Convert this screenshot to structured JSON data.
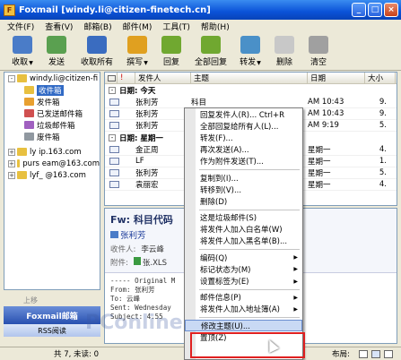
{
  "window": {
    "title": "Foxmail [windy.li@citizen-finetech.cn]",
    "app_icon": "F"
  },
  "menu": [
    "文件(F)",
    "查看(V)",
    "邮箱(B)",
    "邮件(M)",
    "工具(T)",
    "帮助(H)"
  ],
  "toolbar": [
    {
      "label": "收取",
      "icon": "receive-icon",
      "color": "#4a7cc8",
      "dropdown": true
    },
    {
      "label": "发送",
      "icon": "send-icon",
      "color": "#5aa050",
      "dropdown": false
    },
    {
      "label": "收取所有",
      "icon": "receive-all-icon",
      "color": "#3a6cc0",
      "dropdown": false
    },
    {
      "label": "撰写",
      "icon": "compose-icon",
      "color": "#e0a020",
      "dropdown": true
    },
    {
      "label": "回复",
      "icon": "reply-icon",
      "color": "#70a830",
      "dropdown": false
    },
    {
      "label": "全部回复",
      "icon": "reply-all-icon",
      "color": "#70a830",
      "dropdown": false
    },
    {
      "label": "转发",
      "icon": "forward-icon",
      "color": "#4a90c8",
      "dropdown": true
    },
    {
      "label": "删除",
      "icon": "delete-icon",
      "color": "#c8c8c8",
      "dropdown": false
    },
    {
      "label": "清空",
      "icon": "empty-trash-icon",
      "color": "#a0a0a0",
      "dropdown": false
    }
  ],
  "folders": [
    {
      "label": "windy.li@citizen-fi",
      "level": 0,
      "exp": "-",
      "color": "#e8c040",
      "selected": false
    },
    {
      "label": "收件箱",
      "level": 1,
      "exp": "",
      "color": "#e8c040",
      "selected": true
    },
    {
      "label": "发件箱",
      "level": 1,
      "exp": "",
      "color": "#e8a030",
      "selected": false
    },
    {
      "label": "已发送邮件箱",
      "level": 1,
      "exp": "",
      "color": "#d05050",
      "selected": false
    },
    {
      "label": "垃圾邮件箱",
      "level": 1,
      "exp": "",
      "color": "#a060c0",
      "selected": false
    },
    {
      "label": "废件箱",
      "level": 1,
      "exp": "",
      "color": "#9098a0",
      "selected": false
    },
    {
      "label": "ly   ip.163.com",
      "level": 0,
      "exp": "+",
      "color": "#e8c040",
      "selected": false
    },
    {
      "label": "purs   eam@163.com",
      "level": 0,
      "exp": "+",
      "color": "#e8c040",
      "selected": false
    },
    {
      "label": "lyf_   @163.com",
      "level": 0,
      "exp": "+",
      "color": "#e8c040",
      "selected": false
    }
  ],
  "left_bottom": {
    "up": "上移",
    "foxmail": "Foxmail邮箱",
    "rss": "RSS阅读"
  },
  "list_headers": [
    "发件人",
    "主题",
    "日期",
    "大小"
  ],
  "groups": [
    {
      "label": "日期: 今天",
      "rows": [
        {
          "from": "张利芳",
          "subject": "科目",
          "date": "AM 10:43",
          "size": "9."
        },
        {
          "from": "张利芳",
          "subject": "",
          "date": "AM 10:43",
          "size": "9."
        },
        {
          "from": "张利芳",
          "subject": "",
          "date": "AM 9:19",
          "size": "5."
        }
      ]
    },
    {
      "label": "日期: 星期一",
      "rows": [
        {
          "from": "金正周",
          "subject": "",
          "date": "星期一",
          "size": "4."
        },
        {
          "from": "LF",
          "subject": "",
          "date": "星期一",
          "size": "1."
        },
        {
          "from": "张利芳",
          "subject": "",
          "date": "星期一",
          "size": "5."
        },
        {
          "from": "袁丽宏",
          "subject": "",
          "date": "星期一",
          "size": "4."
        }
      ]
    }
  ],
  "preview": {
    "title": "Fw: 科目代码",
    "from": "张利芳",
    "to_label": "收件人:",
    "to": "李云峰",
    "attach_label": "附件:",
    "attach": "张.XLS",
    "body": [
      "----- Original M",
      "From: 张利芳",
      "To: 云峰",
      "Sent: Wednesday",
      "Subject: 4.55"
    ]
  },
  "context_menu": [
    {
      "type": "item",
      "label": "回复发件人(R)...       Ctrl+R",
      "arrow": false
    },
    {
      "type": "item",
      "label": "全部回复给所有人(L)...",
      "arrow": false
    },
    {
      "type": "item",
      "label": "转发(F)...",
      "arrow": false
    },
    {
      "type": "item",
      "label": "再次发送(A)...",
      "arrow": false
    },
    {
      "type": "item",
      "label": "作为附件发送(T)...",
      "arrow": false
    },
    {
      "type": "sep"
    },
    {
      "type": "item",
      "label": "复制到(I)...",
      "arrow": false
    },
    {
      "type": "item",
      "label": "转移到(V)...",
      "arrow": false
    },
    {
      "type": "item",
      "label": "删除(D)",
      "arrow": false
    },
    {
      "type": "sep"
    },
    {
      "type": "item",
      "label": "这是垃圾邮件(S)",
      "arrow": false
    },
    {
      "type": "item",
      "label": "将发件人加入白名单(W)",
      "arrow": false
    },
    {
      "type": "item",
      "label": "将发件人加入黑名单(B)...",
      "arrow": false
    },
    {
      "type": "sep"
    },
    {
      "type": "item",
      "label": "编码(Q)",
      "arrow": true
    },
    {
      "type": "item",
      "label": "标记状态为(M)",
      "arrow": true
    },
    {
      "type": "item",
      "label": "设置标签为(E)",
      "arrow": true
    },
    {
      "type": "sep"
    },
    {
      "type": "item",
      "label": "邮件信息(P)",
      "arrow": true
    },
    {
      "type": "item",
      "label": "将发件人加入地址簿(A)",
      "arrow": true
    },
    {
      "type": "sep"
    },
    {
      "type": "item",
      "label": "修改主题(U)...",
      "arrow": false,
      "highlight": true
    },
    {
      "type": "item",
      "label": "置顶(Z)",
      "arrow": false
    }
  ],
  "status": {
    "count": "共 7, 未读: 0",
    "layout": "布局:"
  },
  "watermark": "PConline.com"
}
